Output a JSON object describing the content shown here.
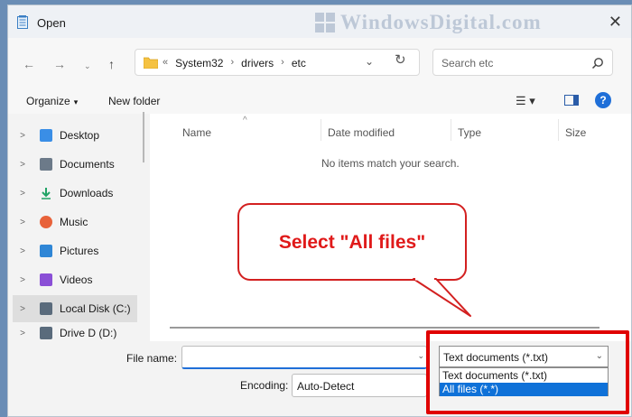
{
  "window": {
    "title": "Open",
    "watermark": "WindowsDigital.com",
    "close_glyph": "✕"
  },
  "navigation": {
    "back_glyph": "←",
    "forward_glyph": "→",
    "recent_glyph": "⌄",
    "up_glyph": "↑",
    "breadcrumb_prefix": "«",
    "breadcrumbs": [
      "System32",
      "drivers",
      "etc"
    ],
    "breadcrumb_separator": "›",
    "address_dropdown_glyph": "⌄",
    "refresh_glyph": "↻",
    "search_placeholder": "Search etc"
  },
  "command_bar": {
    "organize_label": "Organize",
    "organize_caret": "▾",
    "new_folder_label": "New folder",
    "view_glyph": "☰ ▾",
    "help_glyph": "?"
  },
  "sidebar": {
    "items": [
      {
        "label": "Desktop",
        "chevron": ">",
        "icon": "desktop-icon",
        "icon_color": "#3a8ee6"
      },
      {
        "label": "Documents",
        "chevron": ">",
        "icon": "documents-icon",
        "icon_color": "#6c7a89"
      },
      {
        "label": "Downloads",
        "chevron": ">",
        "icon": "downloads-icon",
        "icon_color": "#21a366"
      },
      {
        "label": "Music",
        "chevron": ">",
        "icon": "music-icon",
        "icon_color": "#e8623a"
      },
      {
        "label": "Pictures",
        "chevron": ">",
        "icon": "pictures-icon",
        "icon_color": "#2f86d6"
      },
      {
        "label": "Videos",
        "chevron": ">",
        "icon": "videos-icon",
        "icon_color": "#8a4fd6"
      },
      {
        "label": "Local Disk (C:)",
        "chevron": ">",
        "icon": "drive-icon",
        "icon_color": "#5a6b7c"
      },
      {
        "label": "Drive D (D:)",
        "chevron": ">",
        "icon": "drive-icon",
        "icon_color": "#5a6b7c"
      }
    ]
  },
  "file_list": {
    "columns": [
      "Name",
      "Date modified",
      "Type",
      "Size"
    ],
    "sort_glyph": "^",
    "empty_message": "No items match your search."
  },
  "bottom": {
    "file_name_label": "File name:",
    "file_name_value": "",
    "dropdown_glyph": "⌄",
    "encoding_label": "Encoding:",
    "encoding_value": "Auto-Detect",
    "filter_value": "Text documents (*.txt)",
    "filter_options": [
      "Text documents (*.txt)",
      "All files  (*.*)"
    ],
    "filter_selected_index": 1
  },
  "annotation": {
    "callout_text": "Select \"All files\"",
    "callout_color": "#e01a1a",
    "highlight_color": "#e00000"
  },
  "colors": {
    "accent": "#1f6fd8",
    "selection": "#0f71d8"
  }
}
